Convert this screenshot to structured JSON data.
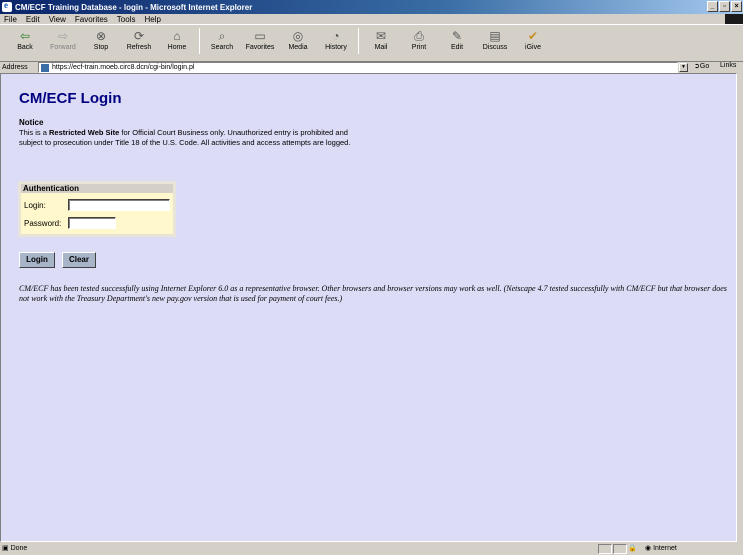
{
  "window": {
    "title": "CM/ECF Training Database - login - Microsoft Internet Explorer"
  },
  "menu": [
    "File",
    "Edit",
    "View",
    "Favorites",
    "Tools",
    "Help"
  ],
  "toolbar": [
    {
      "label": "Back",
      "icon": "back-arrow-icon"
    },
    {
      "label": "Forward",
      "icon": "forward-arrow-icon"
    },
    {
      "label": "Stop",
      "icon": "stop-icon"
    },
    {
      "label": "Refresh",
      "icon": "refresh-icon"
    },
    {
      "label": "Home",
      "icon": "home-icon"
    },
    {
      "label": "Search",
      "icon": "search-icon"
    },
    {
      "label": "Favorites",
      "icon": "favorites-icon"
    },
    {
      "label": "Media",
      "icon": "media-icon"
    },
    {
      "label": "History",
      "icon": "history-icon"
    },
    {
      "label": "Mail",
      "icon": "mail-icon"
    },
    {
      "label": "Print",
      "icon": "print-icon"
    },
    {
      "label": "Edit",
      "icon": "edit-icon"
    },
    {
      "label": "Discuss",
      "icon": "discuss-icon"
    },
    {
      "label": "iGive",
      "icon": "igive-icon"
    }
  ],
  "address": {
    "label": "Address",
    "url": "https://ecf-train.moeb.circ8.dcn/cgi-bin/login.pl",
    "go": "Go",
    "links": "Links"
  },
  "page": {
    "title": "CM/ECF Login",
    "notice_heading": "Notice",
    "notice_pre": "This is a ",
    "notice_bold": "Restricted Web Site",
    "notice_post": " for Official Court Business only. Unauthorized entry is prohibited and subject to prosecution under Title 18 of the U.S. Code. All activities and access attempts are logged.",
    "auth_heading": "Authentication",
    "login_label": "Login:",
    "password_label": "Password:",
    "login_value": "",
    "password_value": "",
    "login_button": "Login",
    "clear_button": "Clear",
    "browser_note": "CM/ECF has been tested successfully using Internet Explorer 6.0 as a representative browser. Other browsers and browser versions may work as well. (Netscape 4.7 tested successfully with CM/ECF but that browser does not work with the Treasury Department's new pay.gov version that is used for payment of court fees.)"
  },
  "status": {
    "text": "Done",
    "zone": "Internet"
  },
  "colors": {
    "page_background": "#dcdcf6",
    "title_blue": "#000080",
    "auth_background": "#fff8cc"
  }
}
